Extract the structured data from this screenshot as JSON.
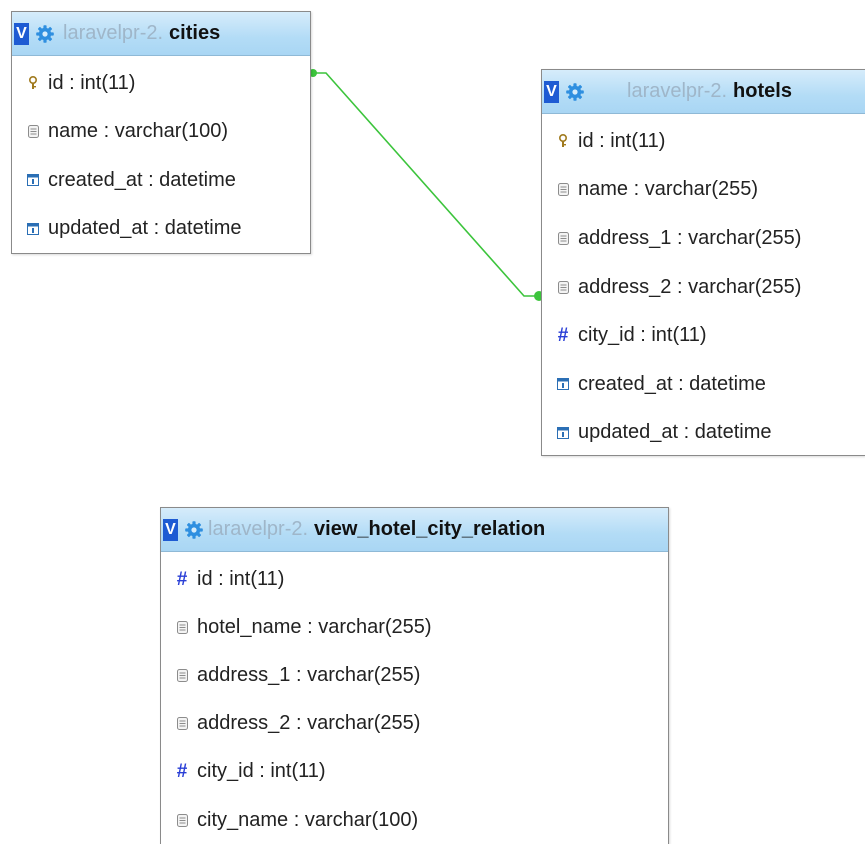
{
  "tables": {
    "cities": {
      "db": "laravelpr-2.",
      "name": "cities",
      "fields": [
        {
          "text": "id : int(11)",
          "icon": "primary-key-icon"
        },
        {
          "text": "name : varchar(100)",
          "icon": "text-field-icon"
        },
        {
          "text": "created_at : datetime",
          "icon": "datetime-field-icon"
        },
        {
          "text": "updated_at : datetime",
          "icon": "datetime-field-icon"
        }
      ]
    },
    "hotels": {
      "db": "laravelpr-2.",
      "name": "hotels",
      "fields": [
        {
          "text": "id : int(11)",
          "icon": "primary-key-icon"
        },
        {
          "text": "name : varchar(255)",
          "icon": "text-field-icon"
        },
        {
          "text": "address_1 : varchar(255)",
          "icon": "text-field-icon"
        },
        {
          "text": "address_2 : varchar(255)",
          "icon": "text-field-icon"
        },
        {
          "text": "city_id : int(11)",
          "icon": "numeric-field-icon"
        },
        {
          "text": "created_at : datetime",
          "icon": "datetime-field-icon"
        },
        {
          "text": "updated_at : datetime",
          "icon": "datetime-field-icon"
        }
      ]
    },
    "view_hotel_city_relation": {
      "db": "laravelpr-2.",
      "name": "view_hotel_city_relation",
      "fields": [
        {
          "text": "id : int(11)",
          "icon": "numeric-field-icon"
        },
        {
          "text": "hotel_name : varchar(255)",
          "icon": "text-field-icon"
        },
        {
          "text": "address_1 : varchar(255)",
          "icon": "text-field-icon"
        },
        {
          "text": "address_2 : varchar(255)",
          "icon": "text-field-icon"
        },
        {
          "text": "city_id : int(11)",
          "icon": "numeric-field-icon"
        },
        {
          "text": "city_name : varchar(100)",
          "icon": "text-field-icon"
        }
      ]
    }
  },
  "header_icons": {
    "toggle_label": "V",
    "toggle_icon": "visibility-toggle-icon",
    "options_icon": "gear-icon"
  },
  "relations": [
    {
      "from": "cities.id",
      "to": "hotels.city_id",
      "color": "#3cc43c"
    }
  ],
  "colors": {
    "header_bg": "#b3dcf6",
    "toggle_bg": "#1e5bd3",
    "db_name": "#9fb6c9",
    "relation": "#3cc43c",
    "numeric_icon": "#2a3fd6"
  }
}
